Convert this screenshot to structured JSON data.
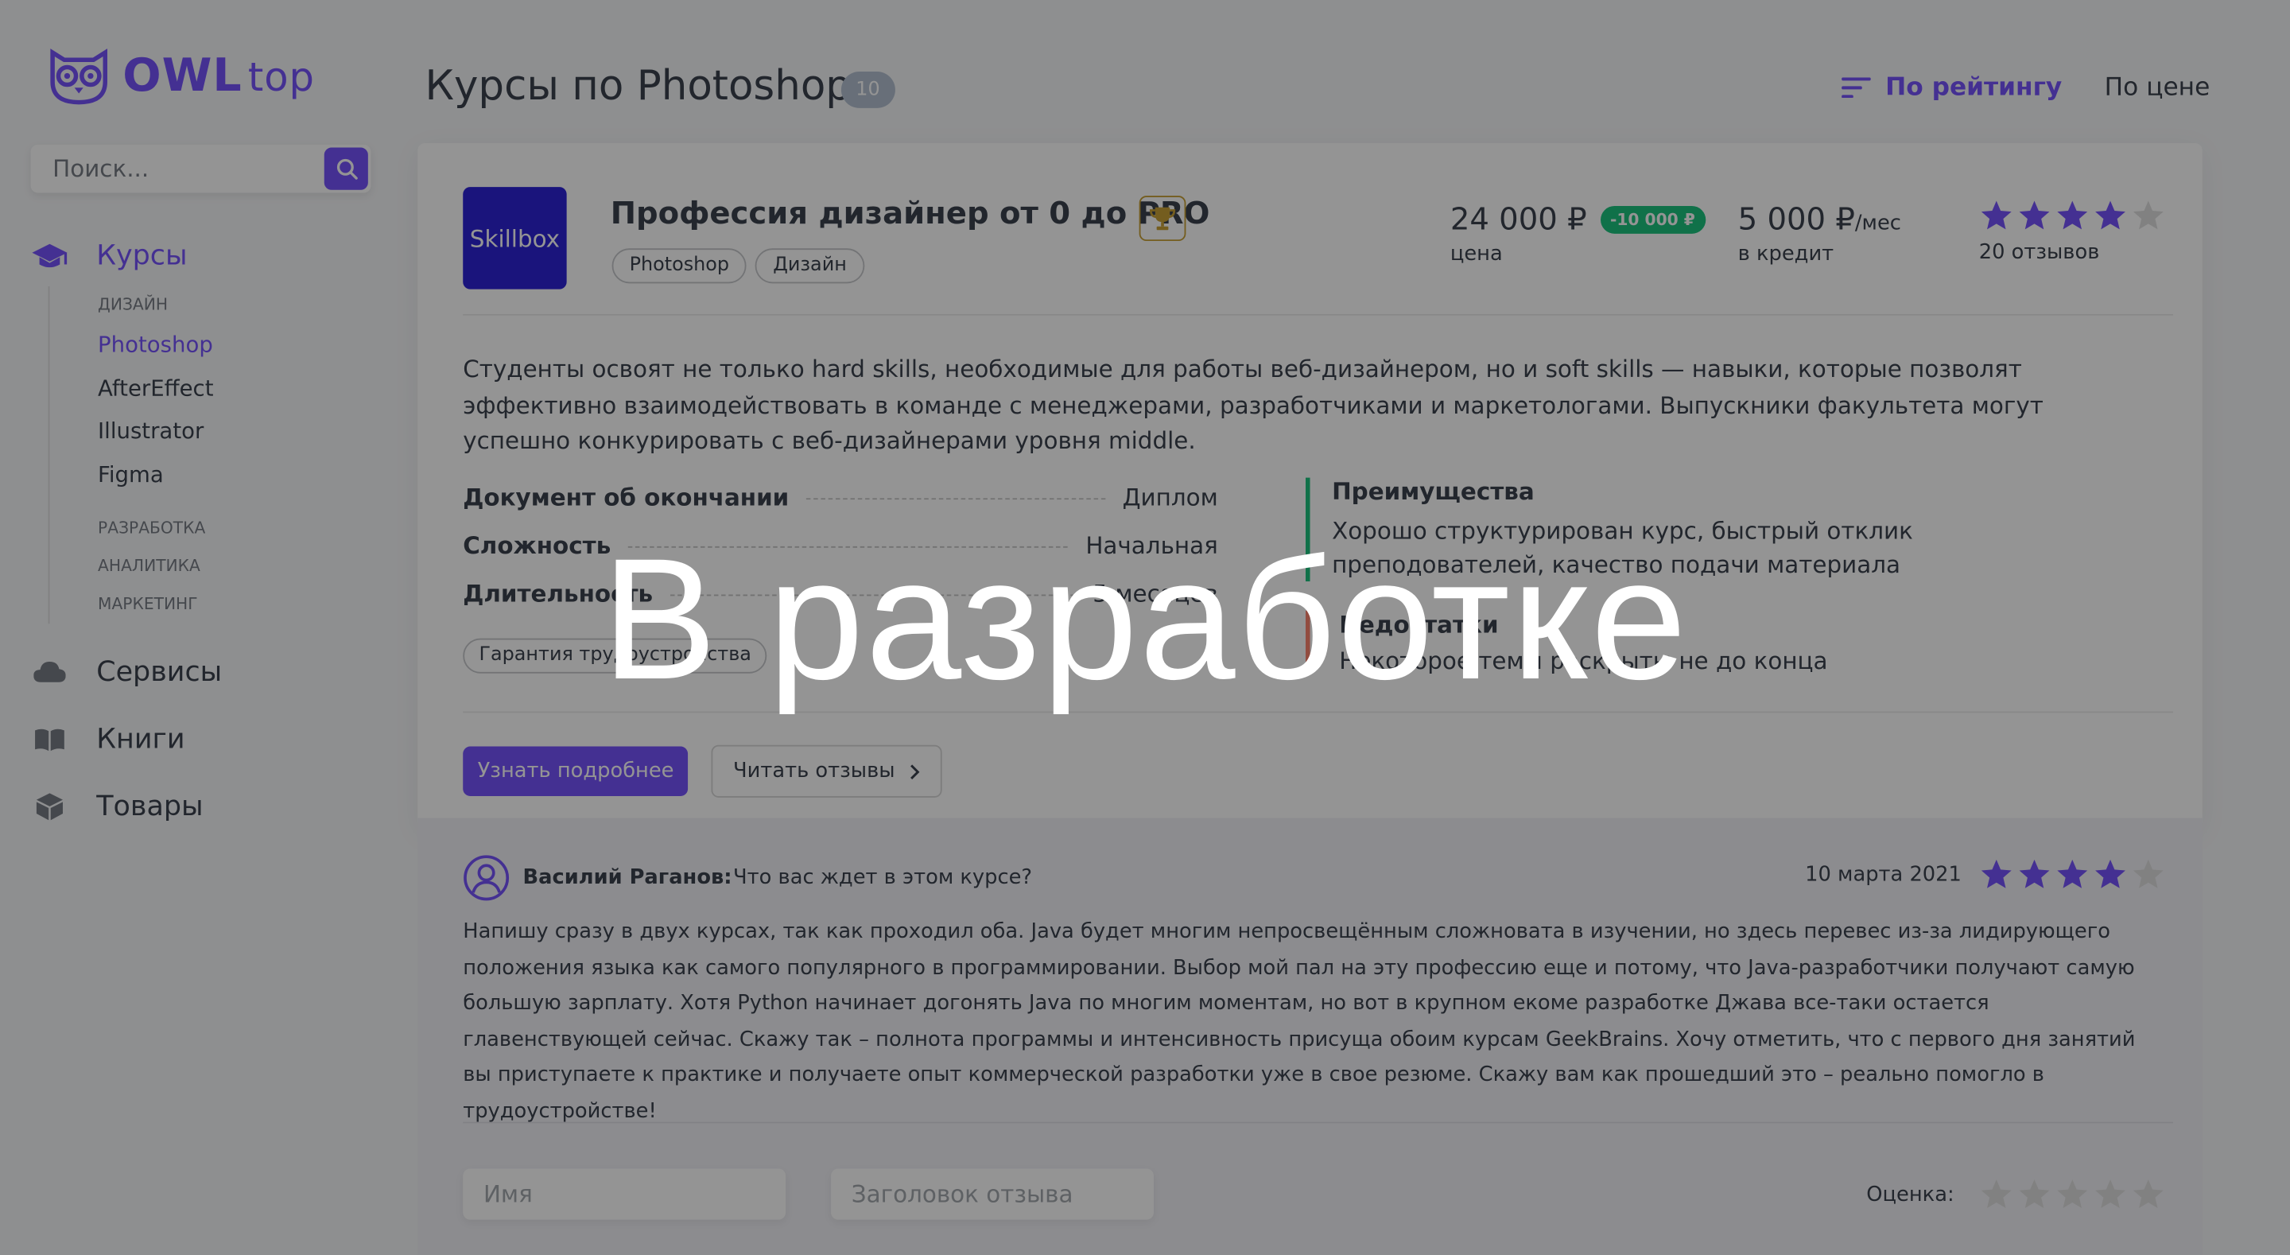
{
  "logo": {
    "brand": "OWL",
    "brand_light": "top"
  },
  "search": {
    "placeholder": "Поиск..."
  },
  "menu": {
    "items": [
      {
        "label": "Курсы",
        "icon": "graduation-cap-icon"
      },
      {
        "label": "Сервисы",
        "icon": "cloud-icon"
      },
      {
        "label": "Книги",
        "icon": "book-icon"
      },
      {
        "label": "Товары",
        "icon": "box-icon"
      }
    ],
    "courses_sub": {
      "design": "Дизайн",
      "design_items": [
        "Photoshop",
        "AfterEffect",
        "Illustrator",
        "Figma"
      ],
      "dev": "Разработка",
      "analytics": "Аналитика",
      "marketing": "Маркетинг"
    }
  },
  "header": {
    "title": "Курсы по Photoshop",
    "count": "10",
    "sort_rating": "По рейтингу",
    "sort_price": "По цене"
  },
  "course": {
    "logo_text": "Skillbox",
    "title": "Профессия дизайнер от 0 до PRO",
    "tags": [
      "Photoshop",
      "Дизайн"
    ],
    "price": "24 000 ₽",
    "discount": "-10 000 ₽",
    "price_label": "цена",
    "credit": "5 000 ₽",
    "credit_unit": "/мес",
    "credit_label": "в кредит",
    "rating": 4,
    "rating_max": 5,
    "reviews_count": "20 отзывов",
    "description": "Студенты освоят не только hard skills, необходимые для работы веб-дизайнером, но и soft skills — навыки, которые позволят эффективно взаимодействовать в команде с менеджерами, разработчиками и маркетологами. Выпускники факультета могут успешно конкурировать с веб-дизайнерами уровня middle.",
    "characteristics": [
      {
        "name": "Документ об окончании",
        "value": "Диплом"
      },
      {
        "name": "Сложность",
        "value": "Начальная"
      },
      {
        "name": "Длительность",
        "value": "5 месяцев"
      }
    ],
    "guarantee": "Гарантия трудоустройства",
    "advantages_title": "Преимущества",
    "advantages_text": "Хорошо структурирован курс, быстрый отклик преподователей, качество подачи материала",
    "disadvantages_title": "Недостатки",
    "disadvantages_text": "Некоторое темы раскрыты не до конца",
    "btn_more": "Узнать подробнее",
    "btn_reviews": "Читать отзывы"
  },
  "review": {
    "author": "Василий Раганов:",
    "title": "Что вас ждет в этом курсе?",
    "date": "10 марта 2021",
    "rating": 4,
    "text": "Напишу сразу в двух курсах, так как проходил оба. Java будет многим непросвещённым сложновата в изучении, но здесь перевес из-за лидирующего положения языка как самого популярного в программировании. Выбор мой пал на эту профессию еще и потому, что Java-разработчики получают самую большую зарплату. Хотя Python начинает догонять Java по многим моментам, но вот в крупном екоме разработке Джава все-таки остается главенствующей сейчас. Скажу так – полнота программы и интенсивность присуща обоим курсам GeekBrains. Хочу отметить, что с первого дня занятий вы приступаете к практике и получаете опыт коммерческой разработки уже в свое резюме. Скажу вам как прошедший это – реально помогло в трудоустройстве!"
  },
  "review_form": {
    "name_placeholder": "Имя",
    "title_placeholder": "Заголовок отзыва",
    "rating_label": "Оценка:"
  },
  "overlay": {
    "text": "В разработке"
  },
  "colors": {
    "accent": "#7653fc",
    "green": "#1cc37e",
    "red": "#fc836d",
    "text": "#3b434e",
    "star_empty": "#dfdfdf"
  }
}
